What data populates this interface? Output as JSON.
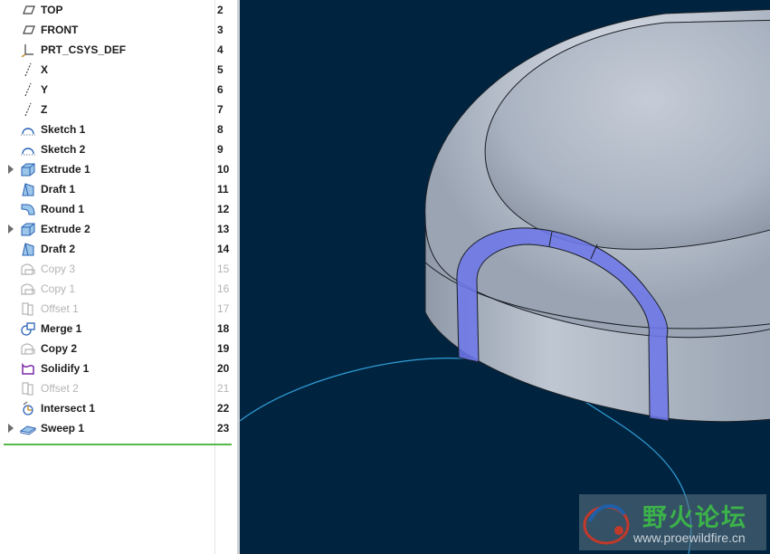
{
  "model_tree": {
    "items": [
      {
        "label": "TOP",
        "number": "2",
        "icon": "datum-plane-icon",
        "expander": false,
        "dim": false
      },
      {
        "label": "FRONT",
        "number": "3",
        "icon": "datum-plane-icon",
        "expander": false,
        "dim": false
      },
      {
        "label": "PRT_CSYS_DEF",
        "number": "4",
        "icon": "coordinate-system-icon",
        "expander": false,
        "dim": false
      },
      {
        "label": "X",
        "number": "5",
        "icon": "datum-axis-icon",
        "expander": false,
        "dim": false
      },
      {
        "label": "Y",
        "number": "6",
        "icon": "datum-axis-icon",
        "expander": false,
        "dim": false
      },
      {
        "label": "Z",
        "number": "7",
        "icon": "datum-axis-icon",
        "expander": false,
        "dim": false
      },
      {
        "label": "Sketch 1",
        "number": "8",
        "icon": "sketch-icon",
        "expander": false,
        "dim": false
      },
      {
        "label": "Sketch 2",
        "number": "9",
        "icon": "sketch-icon",
        "expander": false,
        "dim": false
      },
      {
        "label": "Extrude 1",
        "number": "10",
        "icon": "extrude-icon",
        "expander": true,
        "dim": false
      },
      {
        "label": "Draft 1",
        "number": "11",
        "icon": "draft-icon",
        "expander": false,
        "dim": false
      },
      {
        "label": "Round 1",
        "number": "12",
        "icon": "round-icon",
        "expander": false,
        "dim": false
      },
      {
        "label": "Extrude 2",
        "number": "13",
        "icon": "extrude-icon",
        "expander": true,
        "dim": false
      },
      {
        "label": "Draft 2",
        "number": "14",
        "icon": "draft-icon",
        "expander": false,
        "dim": false
      },
      {
        "label": "Copy 3",
        "number": "15",
        "icon": "copy-icon",
        "expander": false,
        "dim": true
      },
      {
        "label": "Copy 1",
        "number": "16",
        "icon": "copy-icon",
        "expander": false,
        "dim": true
      },
      {
        "label": "Offset 1",
        "number": "17",
        "icon": "offset-icon",
        "expander": false,
        "dim": true
      },
      {
        "label": "Merge 1",
        "number": "18",
        "icon": "merge-icon",
        "expander": false,
        "dim": false
      },
      {
        "label": "Copy 2",
        "number": "19",
        "icon": "copy-icon",
        "expander": false,
        "dim": false
      },
      {
        "label": "Solidify 1",
        "number": "20",
        "icon": "solidify-icon",
        "expander": false,
        "dim": false
      },
      {
        "label": "Offset 2",
        "number": "21",
        "icon": "offset-icon",
        "expander": false,
        "dim": true
      },
      {
        "label": "Intersect 1",
        "number": "22",
        "icon": "intersect-icon",
        "expander": false,
        "dim": false
      },
      {
        "label": "Sweep 1",
        "number": "23",
        "icon": "sweep-icon",
        "expander": true,
        "dim": false
      }
    ]
  },
  "viewport": {
    "background_color": "#002440",
    "highlight_color": "#6e78e8",
    "curve_color": "#2f9ed6"
  },
  "watermark": {
    "title": "野火论坛",
    "url": "www.proewildfire.cn",
    "logo_icon": "wildfire-logo-icon"
  }
}
